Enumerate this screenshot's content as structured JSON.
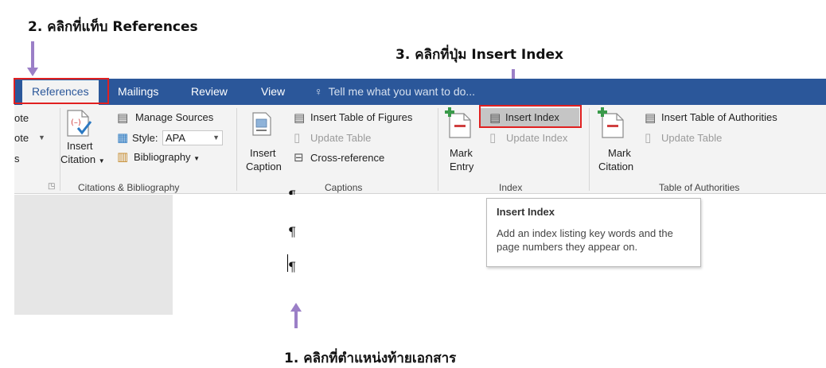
{
  "annotations": {
    "step2": "2. คลิกที่แท็บ References",
    "step3": "3. คลิกที่ปุ่ม Insert Index",
    "step1": "1. คลิกที่ตำแหน่งท้ายเอกสาร"
  },
  "tabs": [
    {
      "label": "References",
      "active": true
    },
    {
      "label": "Mailings",
      "active": false
    },
    {
      "label": "Review",
      "active": false
    },
    {
      "label": "View",
      "active": false
    }
  ],
  "tell_me": {
    "placeholder": "Tell me what you want to do...",
    "icon": "lightbulb-icon"
  },
  "ribbon": {
    "footnotes": {
      "label_top": "ote",
      "label_mid": "ote",
      "label_bottom": "s"
    },
    "citations": {
      "insert_citation": [
        "Insert",
        "Citation"
      ],
      "manage_sources": "Manage Sources",
      "style_label": "Style:",
      "style_value": "APA",
      "bibliography": "Bibliography",
      "group_label": "Citations & Bibliography"
    },
    "captions": {
      "insert_caption": [
        "Insert",
        "Caption"
      ],
      "insert_table_of_figures": "Insert Table of Figures",
      "update_table": "Update Table",
      "cross_reference": "Cross-reference",
      "group_label": "Captions"
    },
    "index": {
      "mark_entry": [
        "Mark",
        "Entry"
      ],
      "insert_index": "Insert Index",
      "update_index": "Update Index",
      "group_label": "Index"
    },
    "authorities": {
      "mark_citation": [
        "Mark",
        "Citation"
      ],
      "insert_table_of_authorities": "Insert Table of Authorities",
      "update_table": "Update Table",
      "group_label": "Table of Authorities"
    }
  },
  "document": {
    "marks": [
      "¶",
      "¶",
      "¶"
    ]
  },
  "tooltip": {
    "title": "Insert Index",
    "description": "Add an index listing key words and the page numbers they appear on."
  },
  "colors": {
    "tab_bar": "#2b579a",
    "ribbon_bg": "#f3f3f3",
    "annotation_arrow": "#9b7fc7",
    "highlight_box": "#e02020"
  }
}
